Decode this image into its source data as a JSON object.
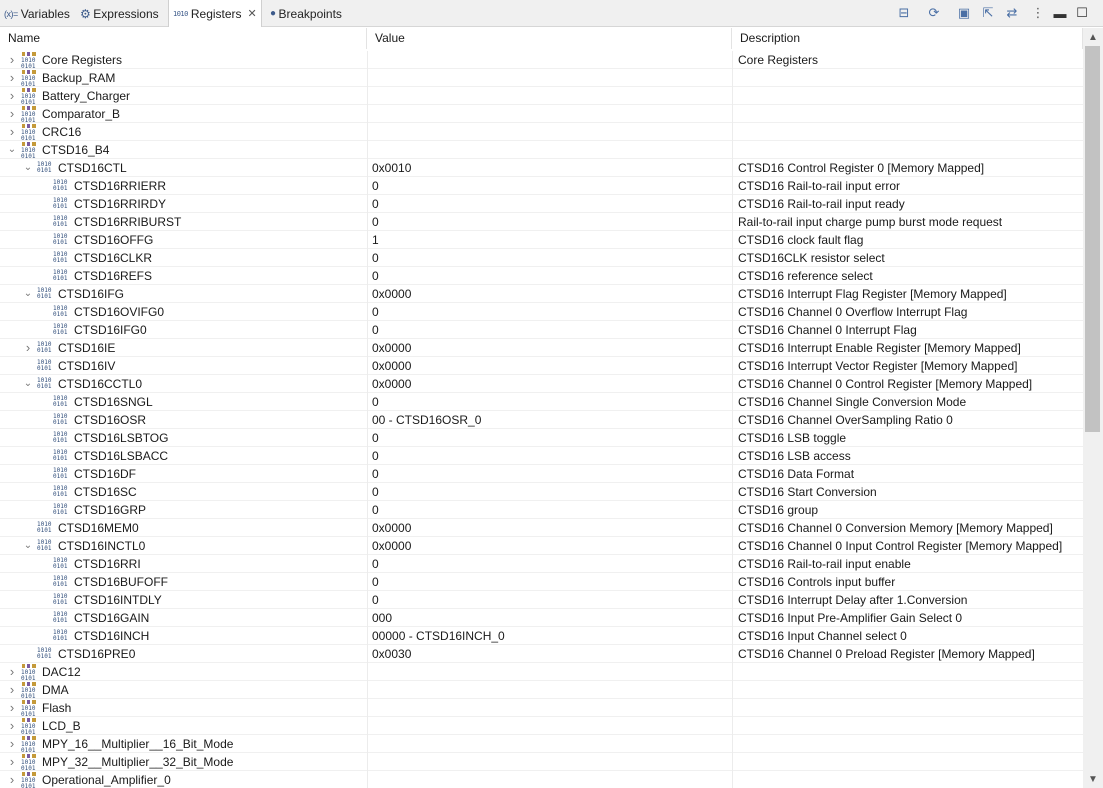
{
  "tabs": [
    {
      "icon_text": "(x)=",
      "label": "Variables",
      "icon": "variables-icon"
    },
    {
      "icon_text": "⚙",
      "label": "Expressions",
      "icon": "expressions-icon"
    },
    {
      "icon_text": "1010",
      "label": "Registers",
      "icon": "registers-icon",
      "active": true
    },
    {
      "icon_text": "●",
      "label": "Breakpoints",
      "icon": "breakpoints-icon"
    }
  ],
  "toolbar_icons": [
    "collapse-all-icon",
    "refresh-icon",
    "new-group-icon",
    "export-icon",
    "sync-icon",
    "view-menu-icon",
    "minimize-icon",
    "maximize-icon"
  ],
  "columns": {
    "name": "Name",
    "value": "Value",
    "description": "Description"
  },
  "icon_text": {
    "bits": "1010\n0101"
  },
  "rows": [
    {
      "level": 0,
      "kind": "group",
      "twisty": "closed",
      "name": "Core Registers",
      "value": "",
      "desc": "Core Registers"
    },
    {
      "level": 0,
      "kind": "group",
      "twisty": "closed",
      "name": "Backup_RAM",
      "value": "",
      "desc": ""
    },
    {
      "level": 0,
      "kind": "group",
      "twisty": "closed",
      "name": "Battery_Charger",
      "value": "",
      "desc": ""
    },
    {
      "level": 0,
      "kind": "group",
      "twisty": "closed",
      "name": "Comparator_B",
      "value": "",
      "desc": ""
    },
    {
      "level": 0,
      "kind": "group",
      "twisty": "closed",
      "name": "CRC16",
      "value": "",
      "desc": ""
    },
    {
      "level": 0,
      "kind": "group",
      "twisty": "open",
      "name": "CTSD16_B4",
      "value": "",
      "desc": ""
    },
    {
      "level": 1,
      "kind": "reg",
      "twisty": "open",
      "name": "CTSD16CTL",
      "value": "0x0010",
      "desc": "CTSD16 Control Register 0 [Memory Mapped]"
    },
    {
      "level": 2,
      "kind": "reg",
      "twisty": "none",
      "name": "CTSD16RRIERR",
      "value": "0",
      "desc": "CTSD16 Rail-to-rail input error"
    },
    {
      "level": 2,
      "kind": "reg",
      "twisty": "none",
      "name": "CTSD16RRIRDY",
      "value": "0",
      "desc": "CTSD16 Rail-to-rail input ready"
    },
    {
      "level": 2,
      "kind": "reg",
      "twisty": "none",
      "name": "CTSD16RRIBURST",
      "value": "0",
      "desc": "Rail-to-rail input charge pump burst mode request"
    },
    {
      "level": 2,
      "kind": "reg",
      "twisty": "none",
      "name": "CTSD16OFFG",
      "value": "1",
      "desc": "CTSD16 clock fault flag"
    },
    {
      "level": 2,
      "kind": "reg",
      "twisty": "none",
      "name": "CTSD16CLKR",
      "value": "0",
      "desc": "CTSD16CLK resistor select"
    },
    {
      "level": 2,
      "kind": "reg",
      "twisty": "none",
      "name": "CTSD16REFS",
      "value": "0",
      "desc": "CTSD16 reference select"
    },
    {
      "level": 1,
      "kind": "reg",
      "twisty": "open",
      "name": "CTSD16IFG",
      "value": "0x0000",
      "desc": "CTSD16 Interrupt Flag Register [Memory Mapped]"
    },
    {
      "level": 2,
      "kind": "reg",
      "twisty": "none",
      "name": "CTSD16OVIFG0",
      "value": "0",
      "desc": "CTSD16 Channel 0 Overflow Interrupt Flag"
    },
    {
      "level": 2,
      "kind": "reg",
      "twisty": "none",
      "name": "CTSD16IFG0",
      "value": "0",
      "desc": "CTSD16 Channel 0 Interrupt Flag"
    },
    {
      "level": 1,
      "kind": "reg",
      "twisty": "closed",
      "name": "CTSD16IE",
      "value": "0x0000",
      "desc": "CTSD16 Interrupt Enable Register [Memory Mapped]"
    },
    {
      "level": 1,
      "kind": "reg",
      "twisty": "none",
      "name": "CTSD16IV",
      "value": "0x0000",
      "desc": "CTSD16 Interrupt Vector Register [Memory Mapped]"
    },
    {
      "level": 1,
      "kind": "reg",
      "twisty": "open",
      "name": "CTSD16CCTL0",
      "value": "0x0000",
      "desc": "CTSD16 Channel 0 Control Register [Memory Mapped]"
    },
    {
      "level": 2,
      "kind": "reg",
      "twisty": "none",
      "name": "CTSD16SNGL",
      "value": "0",
      "desc": "CTSD16 Channel Single Conversion Mode"
    },
    {
      "level": 2,
      "kind": "reg",
      "twisty": "none",
      "name": "CTSD16OSR",
      "value": "00 - CTSD16OSR_0",
      "desc": "CTSD16 Channel OverSampling Ratio 0"
    },
    {
      "level": 2,
      "kind": "reg",
      "twisty": "none",
      "name": "CTSD16LSBTOG",
      "value": "0",
      "desc": "CTSD16 LSB toggle"
    },
    {
      "level": 2,
      "kind": "reg",
      "twisty": "none",
      "name": "CTSD16LSBACC",
      "value": "0",
      "desc": "CTSD16 LSB access"
    },
    {
      "level": 2,
      "kind": "reg",
      "twisty": "none",
      "name": "CTSD16DF",
      "value": "0",
      "desc": "CTSD16 Data Format"
    },
    {
      "level": 2,
      "kind": "reg",
      "twisty": "none",
      "name": "CTSD16SC",
      "value": "0",
      "desc": "CTSD16 Start Conversion"
    },
    {
      "level": 2,
      "kind": "reg",
      "twisty": "none",
      "name": "CTSD16GRP",
      "value": "0",
      "desc": "CTSD16 group"
    },
    {
      "level": 1,
      "kind": "reg",
      "twisty": "none",
      "name": "CTSD16MEM0",
      "value": "0x0000",
      "desc": "CTSD16 Channel 0 Conversion Memory [Memory Mapped]"
    },
    {
      "level": 1,
      "kind": "reg",
      "twisty": "open",
      "name": "CTSD16INCTL0",
      "value": "0x0000",
      "desc": "CTSD16 Channel 0 Input Control Register [Memory Mapped]"
    },
    {
      "level": 2,
      "kind": "reg",
      "twisty": "none",
      "name": "CTSD16RRI",
      "value": "0",
      "desc": "CTSD16 Rail-to-rail input enable"
    },
    {
      "level": 2,
      "kind": "reg",
      "twisty": "none",
      "name": "CTSD16BUFOFF",
      "value": "0",
      "desc": "CTSD16 Controls input buffer"
    },
    {
      "level": 2,
      "kind": "reg",
      "twisty": "none",
      "name": "CTSD16INTDLY",
      "value": "0",
      "desc": "CTSD16 Interrupt Delay after 1.Conversion"
    },
    {
      "level": 2,
      "kind": "reg",
      "twisty": "none",
      "name": "CTSD16GAIN",
      "value": "000",
      "desc": "CTSD16 Input Pre-Amplifier Gain Select 0"
    },
    {
      "level": 2,
      "kind": "reg",
      "twisty": "none",
      "name": "CTSD16INCH",
      "value": "00000 - CTSD16INCH_0",
      "desc": "CTSD16 Input Channel select 0"
    },
    {
      "level": 1,
      "kind": "reg",
      "twisty": "none",
      "name": "CTSD16PRE0",
      "value": "0x0030",
      "desc": "CTSD16 Channel 0 Preload Register [Memory Mapped]"
    },
    {
      "level": 0,
      "kind": "group",
      "twisty": "closed",
      "name": "DAC12",
      "value": "",
      "desc": ""
    },
    {
      "level": 0,
      "kind": "group",
      "twisty": "closed",
      "name": "DMA",
      "value": "",
      "desc": ""
    },
    {
      "level": 0,
      "kind": "group",
      "twisty": "closed",
      "name": "Flash",
      "value": "",
      "desc": ""
    },
    {
      "level": 0,
      "kind": "group",
      "twisty": "closed",
      "name": "LCD_B",
      "value": "",
      "desc": ""
    },
    {
      "level": 0,
      "kind": "group",
      "twisty": "closed",
      "name": "MPY_16__Multiplier__16_Bit_Mode",
      "value": "",
      "desc": ""
    },
    {
      "level": 0,
      "kind": "group",
      "twisty": "closed",
      "name": "MPY_32__Multiplier__32_Bit_Mode",
      "value": "",
      "desc": ""
    },
    {
      "level": 0,
      "kind": "group",
      "twisty": "closed",
      "name": "Operational_Amplifier_0",
      "value": "",
      "desc": ""
    }
  ]
}
